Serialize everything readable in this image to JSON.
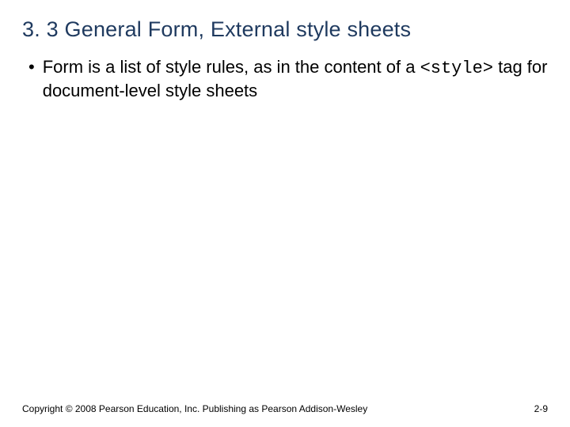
{
  "slide": {
    "title": "3. 3 General Form, External style sheets",
    "bullet": {
      "text_before": "Form is a list of style rules, as in the content of a ",
      "code": "<style>",
      "text_after": " tag for document-level style sheets"
    },
    "footer_left": "Copyright © 2008 Pearson Education, Inc. Publishing as Pearson Addison-Wesley",
    "footer_right": "2-9"
  }
}
